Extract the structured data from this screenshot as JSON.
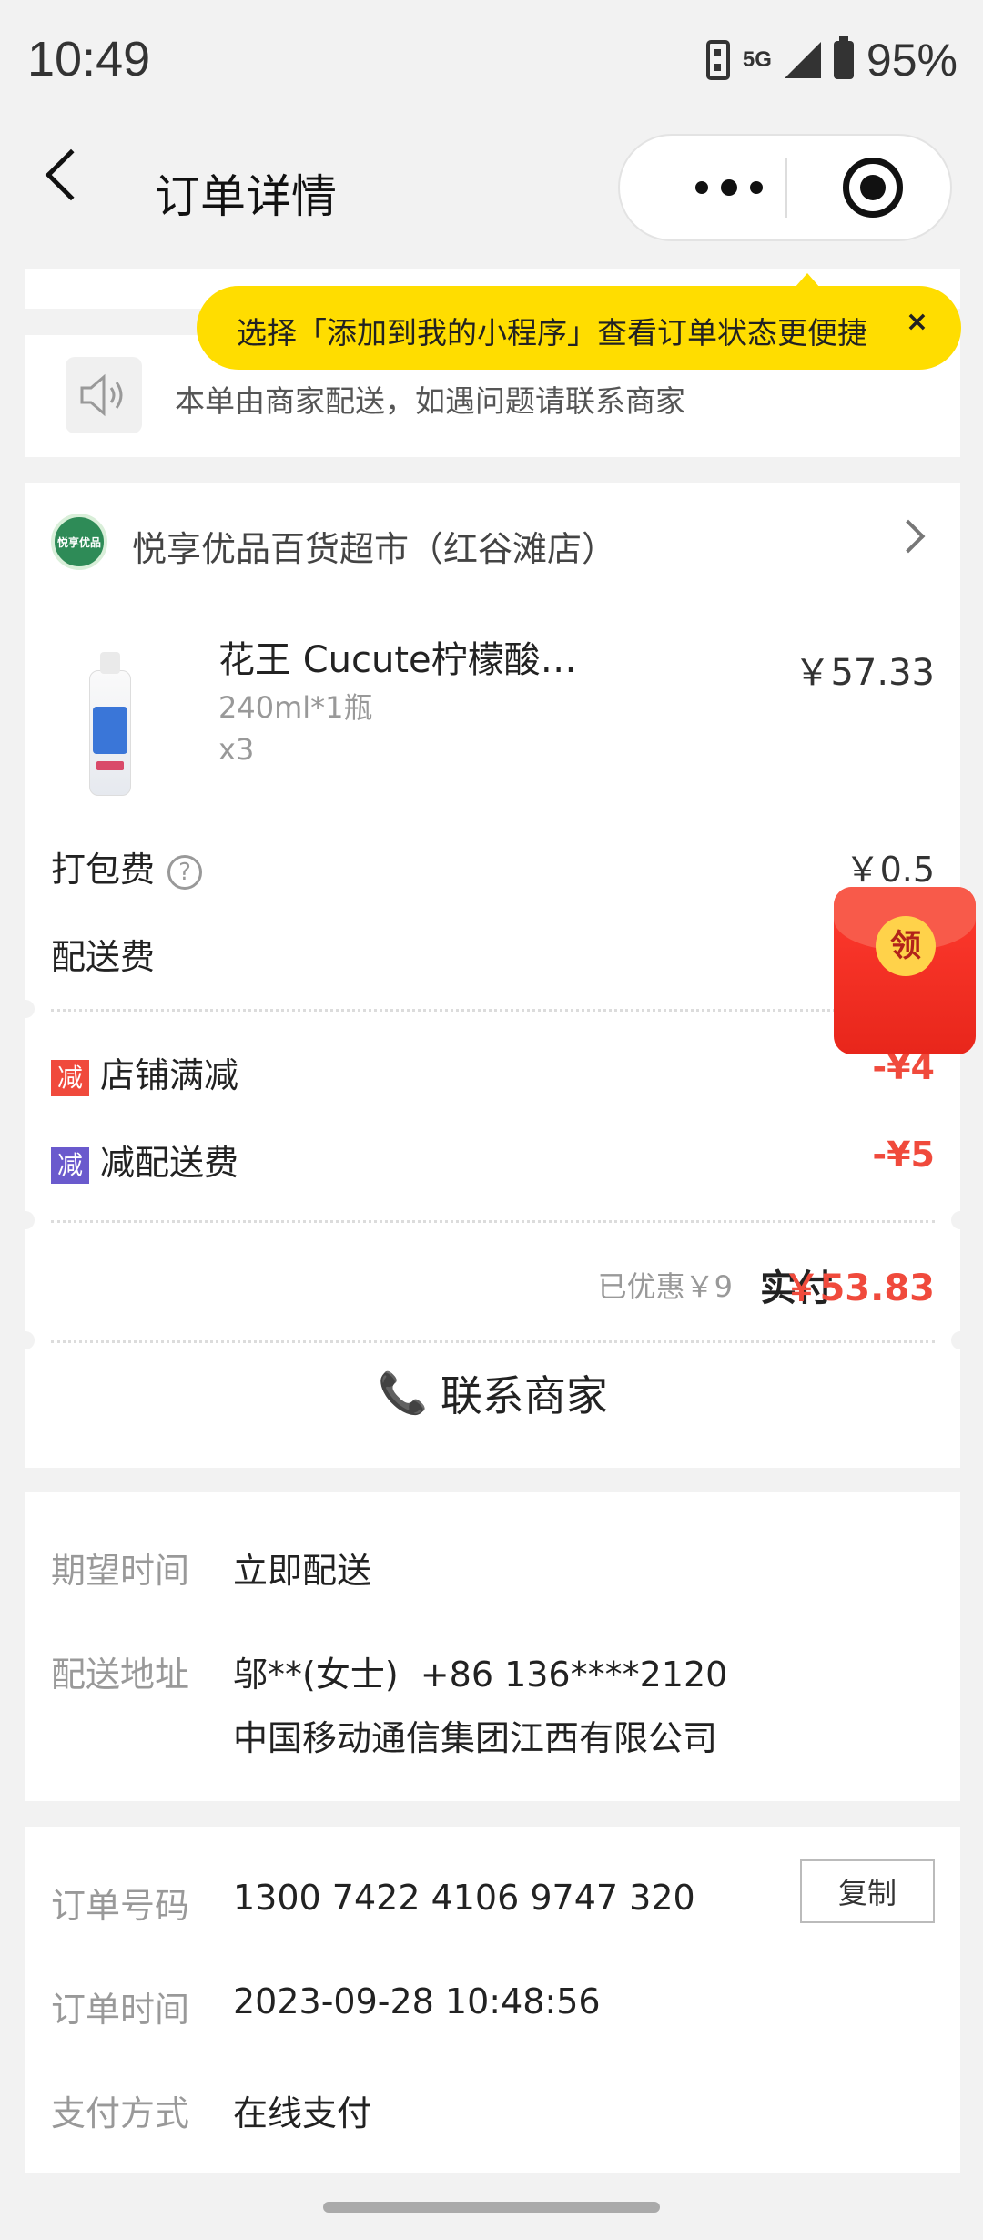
{
  "status_bar": {
    "time": "10:49",
    "network": "5G",
    "battery": "95%"
  },
  "header": {
    "title": "订单详情"
  },
  "tooltip": {
    "text": "选择「添加到我的小程序」查看订单状态更便捷",
    "close": "×"
  },
  "notice": {
    "text": "本单由商家配送，如遇问题请联系商家"
  },
  "shop": {
    "name": "悦享优品百货超市（红谷滩店）",
    "logo_text": "悦享优品"
  },
  "product": {
    "name": "花王 Cucute柠檬酸…",
    "spec": "240ml*1瓶",
    "qty": "x3",
    "price": "￥57.33"
  },
  "fees": {
    "packing_label": "打包费",
    "packing_value": "￥0.5",
    "help": "?",
    "delivery_label": "配送费"
  },
  "discounts": [
    {
      "badge": "减",
      "label": "店铺满减",
      "value": "-¥4"
    },
    {
      "badge": "减",
      "label": "减配送费",
      "value": "-¥5"
    }
  ],
  "summary": {
    "saved": "已优惠￥9",
    "paid_label": "实付",
    "paid_value": "￥53.83"
  },
  "contact": {
    "label": "联系商家"
  },
  "red_packet": {
    "label": "领"
  },
  "delivery": {
    "expect_label": "期望时间",
    "expect_value": "立即配送",
    "address_label": "配送地址",
    "address_contact": "邬**(女士)  +86 136****2120",
    "address_line": "中国移动通信集团江西有限公司"
  },
  "order_info": {
    "number_label": "订单号码",
    "number_value": "1300 7422 4106 9747 320",
    "copy_label": "复制",
    "time_label": "订单时间",
    "time_value": "2023-09-28 10:48:56",
    "pay_label": "支付方式",
    "pay_value": "在线支付"
  },
  "colors": {
    "accent_red": "#f04a3c",
    "tooltip_yellow": "#ffdd00",
    "discount_purple": "#6a5acd"
  }
}
